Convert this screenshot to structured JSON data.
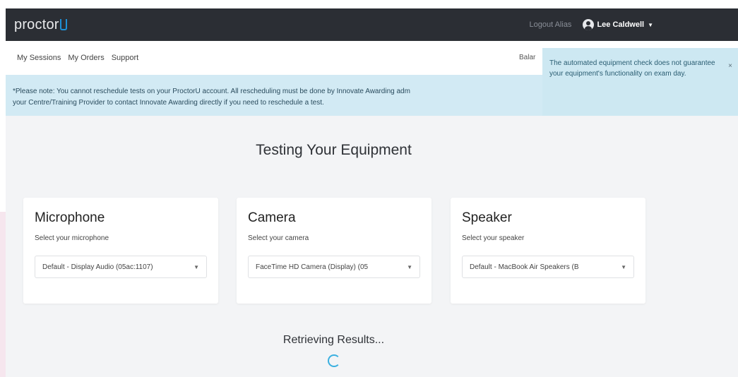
{
  "header": {
    "logo_text": "proctor",
    "logout_label": "Logout Alias",
    "username": "Lee Caldwell"
  },
  "subnav": {
    "items": [
      {
        "label": "My Sessions"
      },
      {
        "label": "My Orders"
      },
      {
        "label": "Support"
      }
    ],
    "balance_label": "Balar"
  },
  "notice": {
    "line1": "*Please note: You cannot reschedule tests on your ProctorU account. All rescheduling must be done by Innovate Awarding adm",
    "line2": "your Centre/Training Provider to contact Innovate Awarding directly if you need to reschedule a test."
  },
  "toast": {
    "message": "The automated equipment check does not guarantee your equipment's functionality on exam day.",
    "close_label": "×"
  },
  "main": {
    "heading": "Testing Your Equipment",
    "status": "Retrieving Results..."
  },
  "cards": [
    {
      "title": "Microphone",
      "subtitle": "Select your microphone",
      "selected": "Default - Display Audio (05ac:1107)"
    },
    {
      "title": "Camera",
      "subtitle": "Select your camera",
      "selected": "FaceTime HD Camera (Display) (05"
    },
    {
      "title": "Speaker",
      "subtitle": "Select your speaker",
      "selected": "Default - MacBook Air Speakers (B"
    }
  ],
  "colors": {
    "navbar": "#2b2e34",
    "notice_bg": "#d2eaf4",
    "toast_bg": "#cde8f2",
    "accent": "#1e90d6",
    "spinner": "#3bb0e0"
  },
  "icons": {
    "user": "user-avatar-icon",
    "caret": "chevron-down-icon",
    "close": "close-icon",
    "spinner": "loading-spinner-icon"
  }
}
